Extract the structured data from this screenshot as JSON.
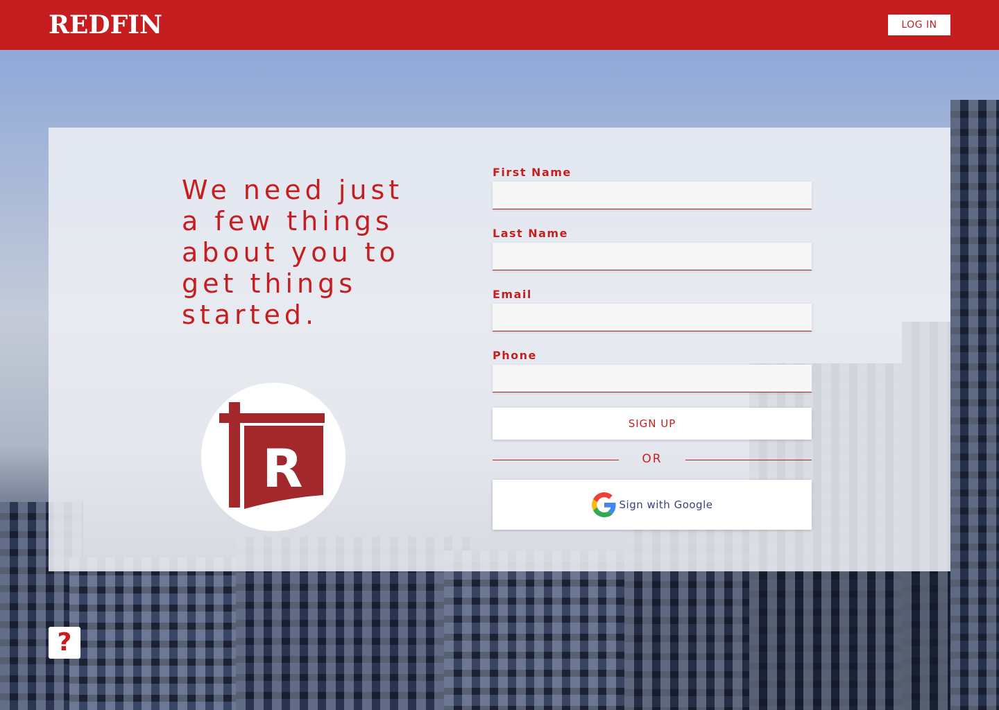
{
  "header": {
    "logo_text": "REDFIN",
    "login_label": "LOG IN"
  },
  "hero": {
    "headline": "We need just a few things about you to get things started."
  },
  "form": {
    "first_name_label": "First Name",
    "last_name_label": "Last Name",
    "email_label": "Email",
    "phone_label": "Phone",
    "first_name_value": "",
    "last_name_value": "",
    "email_value": "",
    "phone_value": "",
    "signup_label": "SIGN UP",
    "or_label": "OR",
    "google_label": "Sign with Google"
  },
  "help": {
    "label": "?"
  },
  "colors": {
    "brand_red": "#c61e20",
    "white": "#ffffff"
  },
  "icons": {
    "brand": "redfin-r-sign-icon",
    "google": "google-g-icon",
    "help": "question-mark-icon"
  }
}
